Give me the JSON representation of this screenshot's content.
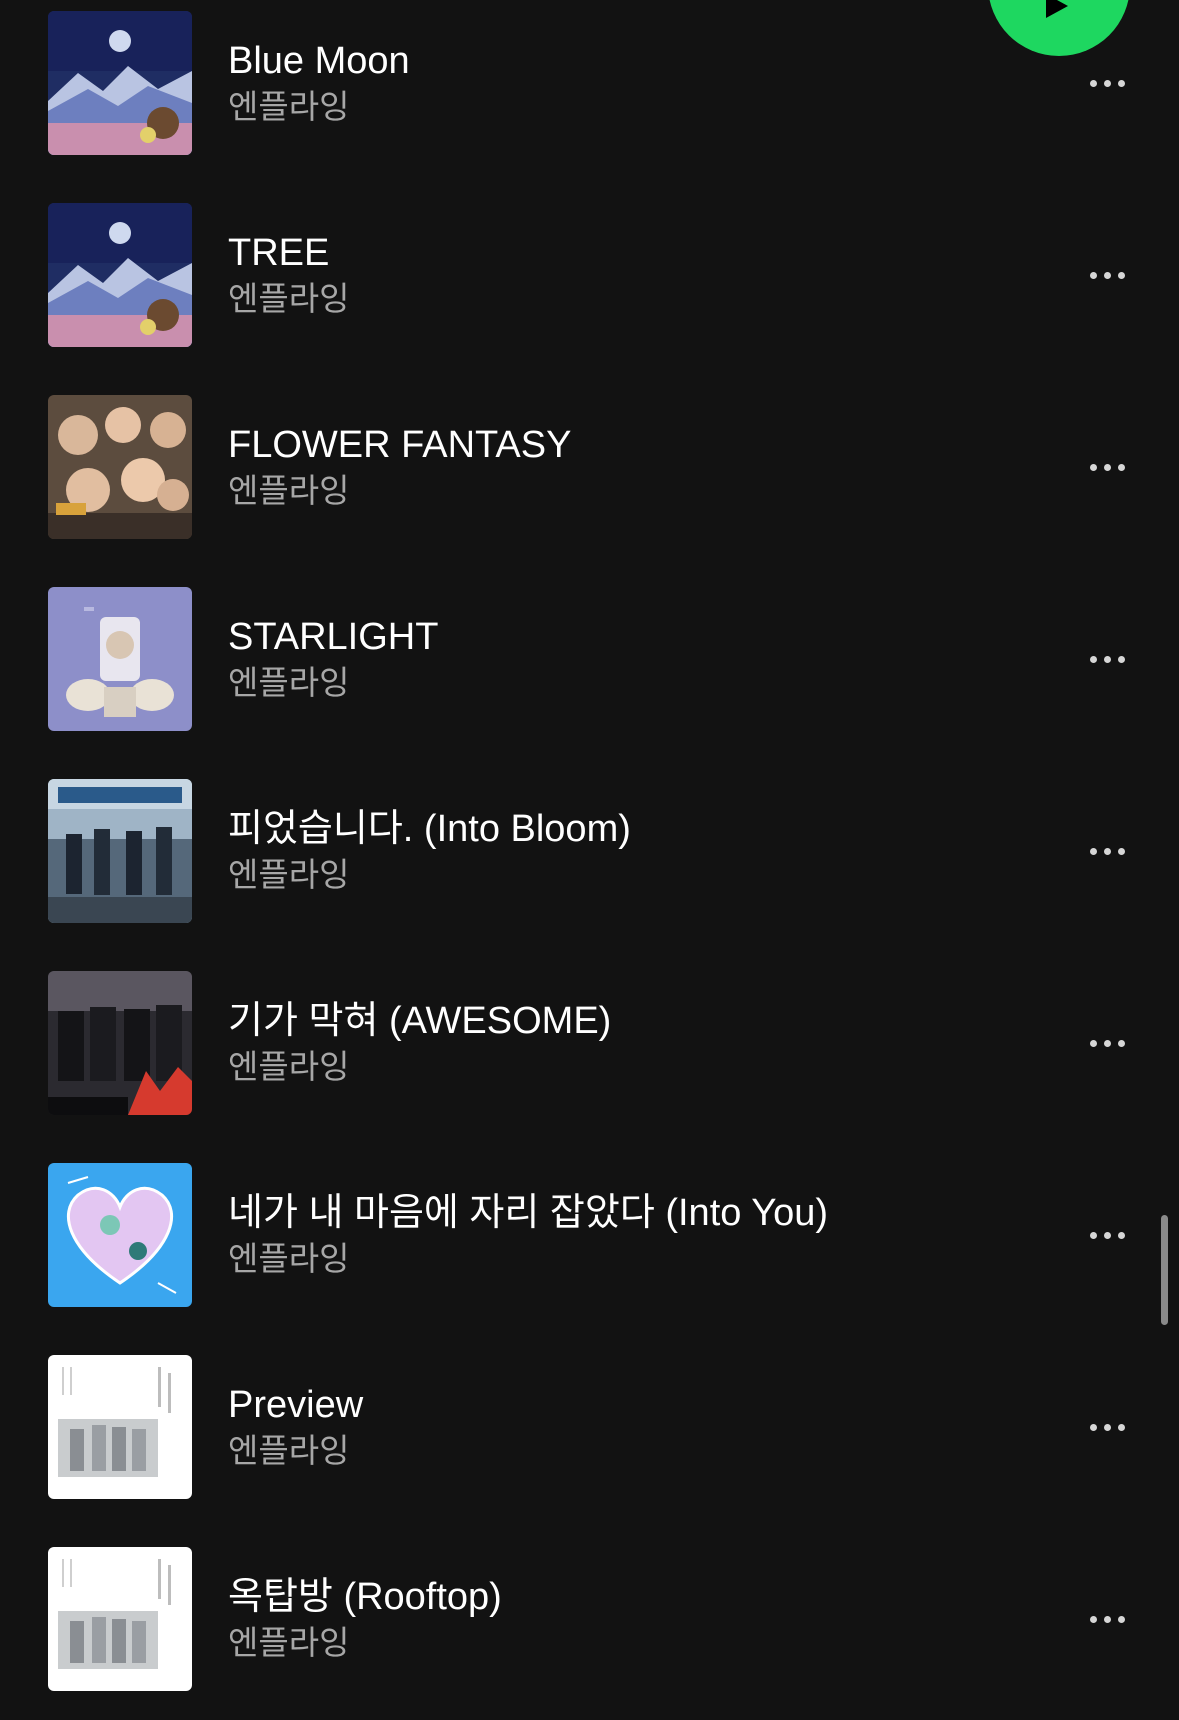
{
  "colors": {
    "background": "#121212",
    "title_text": "#ffffff",
    "artist_text": "#a7a7a7",
    "accent_green": "#1ed760"
  },
  "play_button": {
    "icon": "play-icon"
  },
  "tracks": [
    {
      "title": "Blue Moon",
      "artist": "엔플라잉",
      "cover": "moon-mountain-art"
    },
    {
      "title": "TREE",
      "artist": "엔플라잉",
      "cover": "moon-mountain-art"
    },
    {
      "title": "FLOWER FANTASY",
      "artist": "엔플라잉",
      "cover": "group-photo-art"
    },
    {
      "title": "STARLIGHT",
      "artist": "엔플라잉",
      "cover": "starlight-art"
    },
    {
      "title": "피었습니다. (Into Bloom)",
      "artist": "엔플라잉",
      "cover": "turbulence-art"
    },
    {
      "title": "기가 막혀 (AWESOME)",
      "artist": "엔플라잉",
      "cover": "awesome-art"
    },
    {
      "title": "네가 내 마음에 자리 잡았다 (Into You)",
      "artist": "엔플라잉",
      "cover": "heart-art"
    },
    {
      "title": "Preview",
      "artist": "엔플라잉",
      "cover": "white-photo-art"
    },
    {
      "title": "옥탑방 (Rooftop)",
      "artist": "엔플라잉",
      "cover": "white-photo-art"
    }
  ],
  "more_icon": "more-options-icon"
}
